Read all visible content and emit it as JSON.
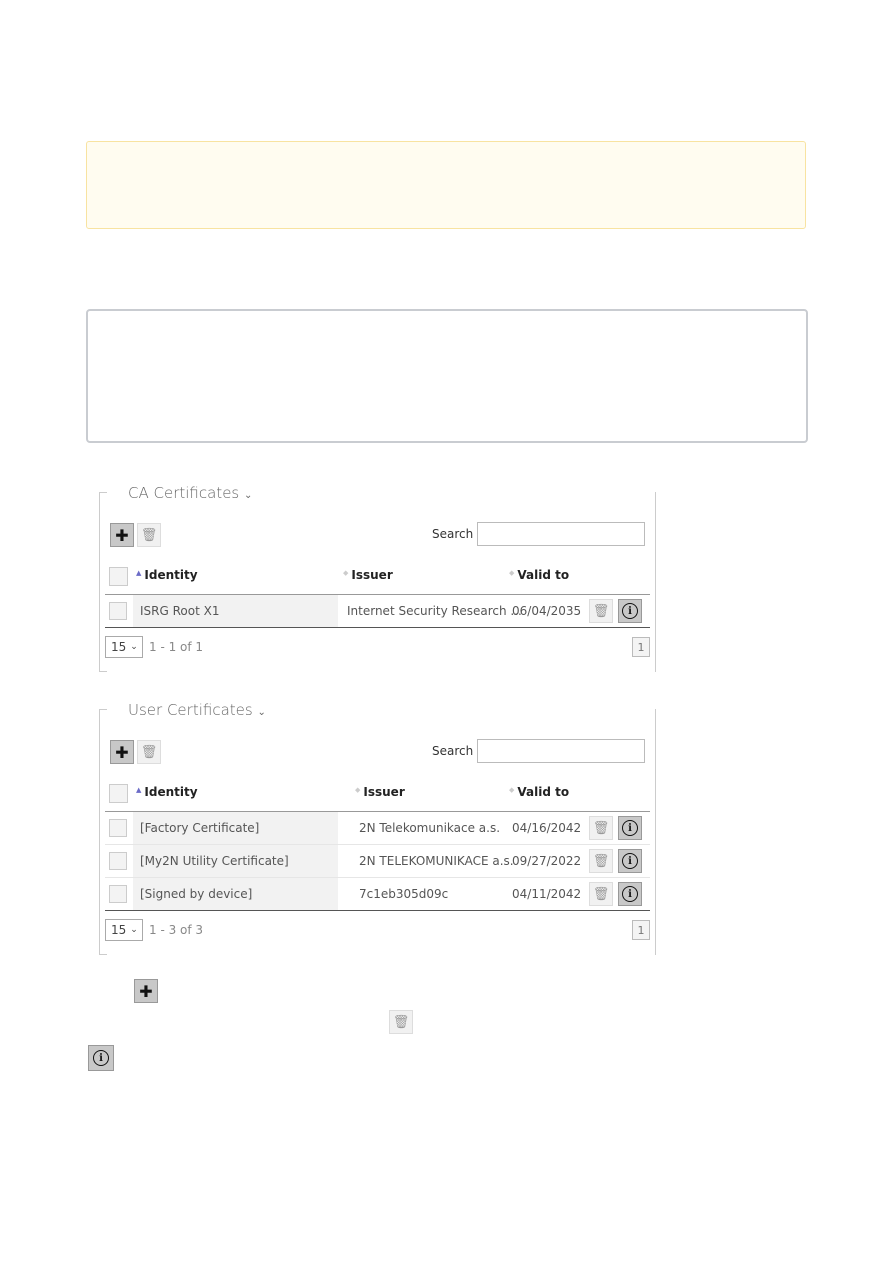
{
  "ca": {
    "title": "CA Certificates",
    "search_label": "Search",
    "search_value": "",
    "columns": [
      "Identity",
      "Issuer",
      "Valid to"
    ],
    "rows": [
      {
        "identity": "ISRG Root X1",
        "issuer": "Internet Security Research ...",
        "valid_to": "06/04/2035"
      }
    ],
    "page_size": "15",
    "range": "1 - 1 of 1",
    "page": "1"
  },
  "user": {
    "title": "User Certificates",
    "search_label": "Search",
    "search_value": "",
    "columns": [
      "Identity",
      "Issuer",
      "Valid to"
    ],
    "rows": [
      {
        "identity": "[Factory Certificate]",
        "issuer": "2N Telekomunikace a.s.",
        "valid_to": "04/16/2042"
      },
      {
        "identity": "[My2N Utility Certificate]",
        "issuer": "2N TELEKOMUNIKACE a.s.",
        "valid_to": "09/27/2022"
      },
      {
        "identity": "[Signed by device]",
        "issuer": "7c1eb305d09c",
        "valid_to": "04/11/2042"
      }
    ],
    "page_size": "15",
    "range": "1 - 3 of 3",
    "page": "1"
  },
  "icons": {
    "add": "plus-icon",
    "delete": "trash-icon",
    "info": "info-circle-icon",
    "sort": "sort-arrows-icon",
    "collapse": "chevron-down-icon"
  },
  "colors": {
    "warning_bg": "#fffcf0",
    "warning_border": "#f8e3a1",
    "sort_active": "#6b6bc7"
  }
}
